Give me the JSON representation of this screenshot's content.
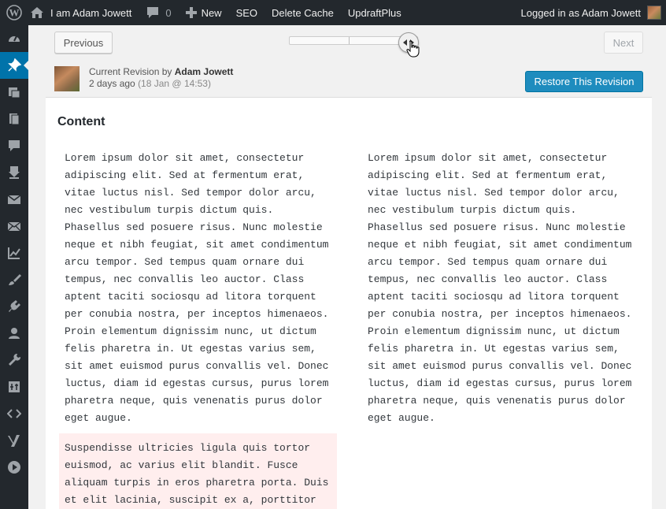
{
  "adminbar": {
    "site_name": "I am Adam Jowett",
    "comments_count": "0",
    "new_label": "New",
    "seo_label": "SEO",
    "delete_cache_label": "Delete Cache",
    "updraft_label": "UpdraftPlus",
    "logged_in_label": "Logged in as Adam Jowett"
  },
  "revisions": {
    "previous_label": "Previous",
    "next_label": "Next",
    "slider_position": 1.0,
    "current_label": "Current Revision by ",
    "author": "Adam Jowett",
    "relative_time": "2 days ago",
    "absolute_time": "(18 Jan @ 14:53)",
    "restore_label": "Restore This Revision"
  },
  "diff": {
    "heading": "Content",
    "left_text": "Lorem ipsum dolor sit amet, consectetur\nadipiscing elit. Sed at fermentum erat,\nvitae luctus nisl. Sed tempor dolor arcu,\nnec vestibulum turpis dictum quis.\nPhasellus sed posuere risus. Nunc molestie\nneque et nibh feugiat, sit amet condimentum\narcu tempor. Sed tempus quam ornare dui\ntempus, nec convallis leo auctor. Class\naptent taciti sociosqu ad litora torquent\nper conubia nostra, per inceptos himenaeos.\nProin elementum dignissim nunc, ut dictum\nfelis pharetra in. Ut egestas varius sem,\nsit amet euismod purus convallis vel. Donec\nluctus, diam id egestas cursus, purus lorem\npharetra neque, quis venenatis purus dolor\neget augue.",
    "right_text": "Lorem ipsum dolor sit amet, consectetur\nadipiscing elit. Sed at fermentum erat,\nvitae luctus nisl. Sed tempor dolor arcu,\nnec vestibulum turpis dictum quis.\nPhasellus sed posuere risus. Nunc molestie\nneque et nibh feugiat, sit amet condimentum\narcu tempor. Sed tempus quam ornare dui\ntempus, nec convallis leo auctor. Class\naptent taciti sociosqu ad litora torquent\nper conubia nostra, per inceptos himenaeos.\nProin elementum dignissim nunc, ut dictum\nfelis pharetra in. Ut egestas varius sem,\nsit amet euismod purus convallis vel. Donec\nluctus, diam id egestas cursus, purus lorem\npharetra neque, quis venenatis purus dolor\neget augue.",
    "deleted_text": "Suspendisse ultricies ligula quis tortor\neuismod, ac varius elit blandit. Fusce\naliquam turpis in eros pharetra porta. Duis\net elit lacinia, suscipit ex a, porttitor"
  },
  "menu_icons": [
    "dashboard-icon",
    "posts-pin-icon",
    "media-icon",
    "pages-icon",
    "comments-icon",
    "download-icon",
    "mail-icon",
    "mail-alt-icon",
    "analytics-icon",
    "appearance-brush-icon",
    "plugins-icon",
    "users-icon",
    "tools-wrench-icon",
    "settings-icon",
    "code-icon",
    "yoast-icon",
    "play-icon"
  ],
  "colors": {
    "adminbar_bg": "#23282d",
    "accent": "#0073aa",
    "restore_button": "#1e8cbe",
    "deleted_bg": "#ffeeee"
  }
}
